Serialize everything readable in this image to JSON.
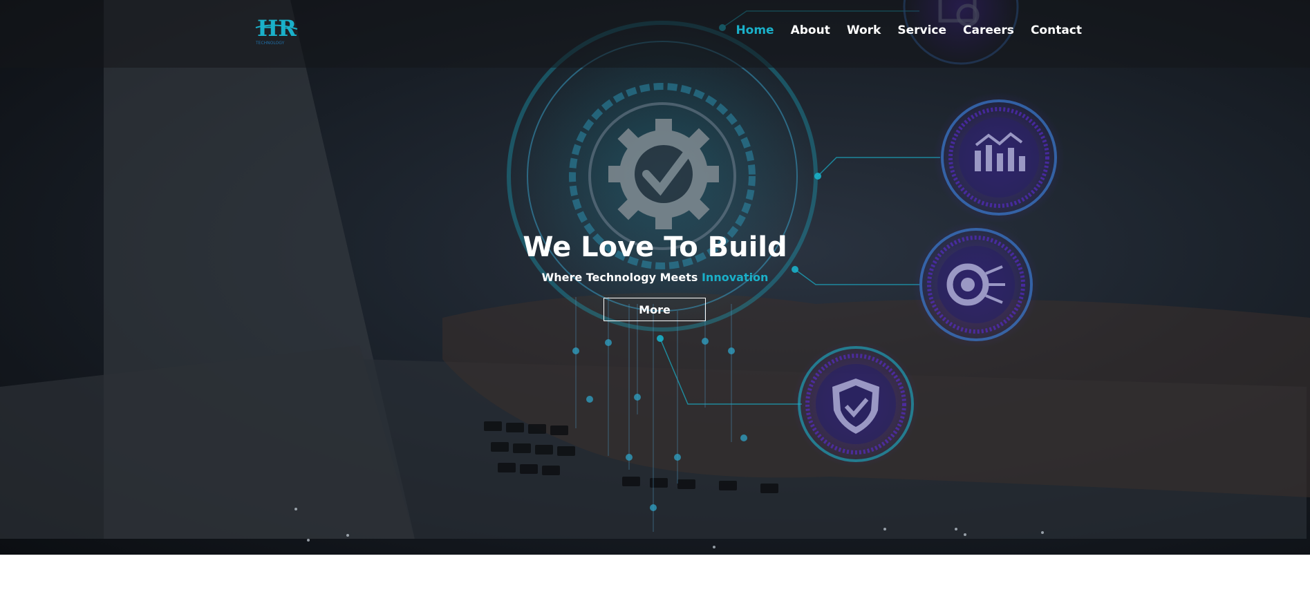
{
  "header": {
    "logo": {
      "mark": "HR",
      "tagline": "TECHNOLOGY"
    },
    "nav": [
      {
        "label": "Home",
        "active": true
      },
      {
        "label": "About"
      },
      {
        "label": "Work"
      },
      {
        "label": "Service"
      },
      {
        "label": "Careers"
      },
      {
        "label": "Contact"
      }
    ]
  },
  "hero": {
    "title": "We Love To Build",
    "subtitle_prefix": "Where Technology Meets ",
    "subtitle_accent": "Innovation",
    "cta_label": "More",
    "icons": [
      "gear-check-icon",
      "bar-chart-icon",
      "gear-circuit-icon",
      "shield-check-icon",
      "document-gear-icon"
    ]
  },
  "colors": {
    "accent": "#1ab0c9",
    "header_bg": "#14161a",
    "hero_bg": "#1c232c"
  }
}
